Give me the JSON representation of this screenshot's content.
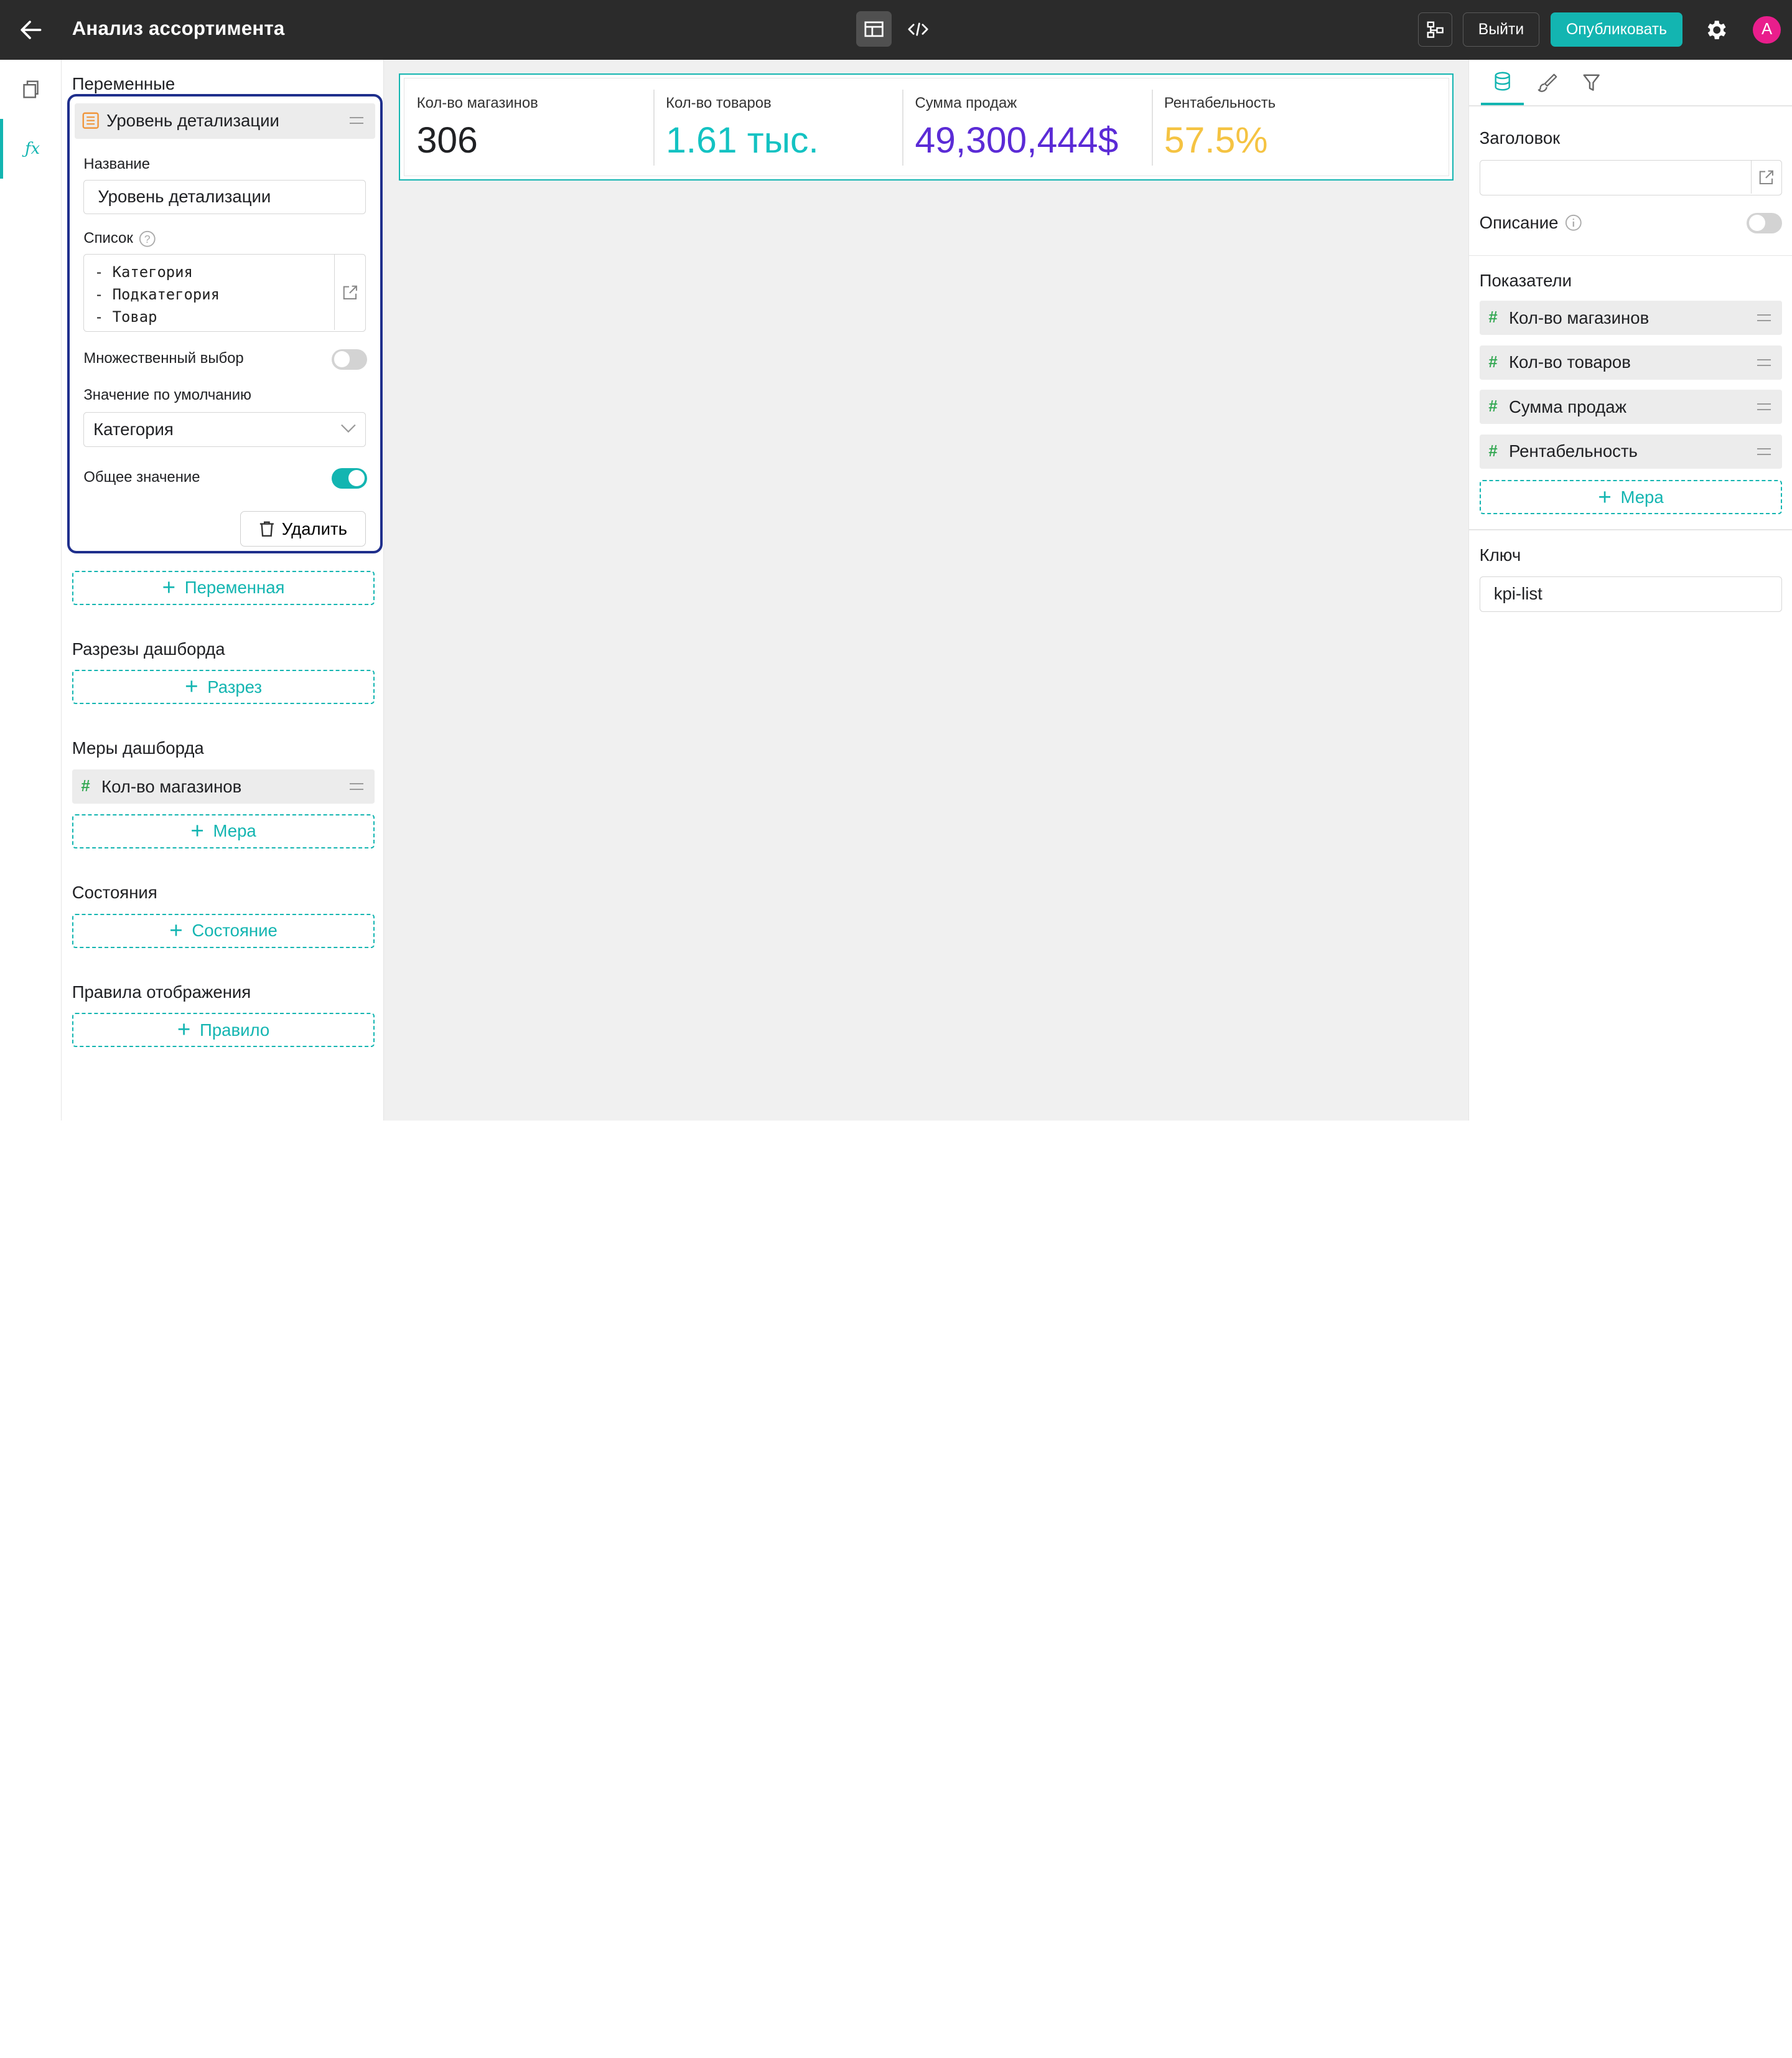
{
  "header": {
    "title": "Анализ ассортимента",
    "exit_label": "Выйти",
    "publish_label": "Опубликовать",
    "avatar_letter": "A",
    "bg_color": "#2b2b2b",
    "accent_color": "#13b5b1",
    "avatar_color": "#e91e8c"
  },
  "left_panel": {
    "variables_title": "Переменные",
    "variable": {
      "name": "Уровень детализации",
      "name_label": "Название",
      "name_value": "Уровень детализации",
      "list_label": "Список",
      "list_items": "- Категория\n- Подкатегория\n- Товар",
      "multi_select_label": "Множественный выбор",
      "multi_select": false,
      "default_label": "Значение по умолчанию",
      "default_value": "Категория",
      "shared_label": "Общее значение",
      "shared": true,
      "delete_label": "Удалить"
    },
    "add_variable_label": "Переменная",
    "slices_title": "Разрезы дашборда",
    "add_slice_label": "Разрез",
    "measures_title": "Меры дашборда",
    "measures": [
      "Кол-во магазинов"
    ],
    "add_measure_label": "Мера",
    "states_title": "Состояния",
    "add_state_label": "Состояние",
    "rules_title": "Правила отображения",
    "add_rule_label": "Правило"
  },
  "kpis": [
    {
      "label": "Кол-во магазинов",
      "value": "306",
      "color": "#202124"
    },
    {
      "label": "Кол-во товаров",
      "value": "1.61 тыс.",
      "color": "#13c2c2"
    },
    {
      "label": "Сумма продаж",
      "value": "49,300,444$",
      "color": "#5b2bd6"
    },
    {
      "label": "Рентабельность",
      "value": "57.5%",
      "color": "#f5c342"
    }
  ],
  "right_panel": {
    "tabs": [
      "database-icon",
      "brush-icon",
      "filter-icon"
    ],
    "header_label": "Заголовок",
    "header_value": "",
    "description_label": "Описание",
    "description_enabled": false,
    "indicators_title": "Показатели",
    "indicators": [
      "Кол-во магазинов",
      "Кол-во товаров",
      "Сумма продаж",
      "Рентабельность"
    ],
    "add_measure_label": "Мера",
    "key_label": "Ключ",
    "key_value": "kpi-list"
  }
}
